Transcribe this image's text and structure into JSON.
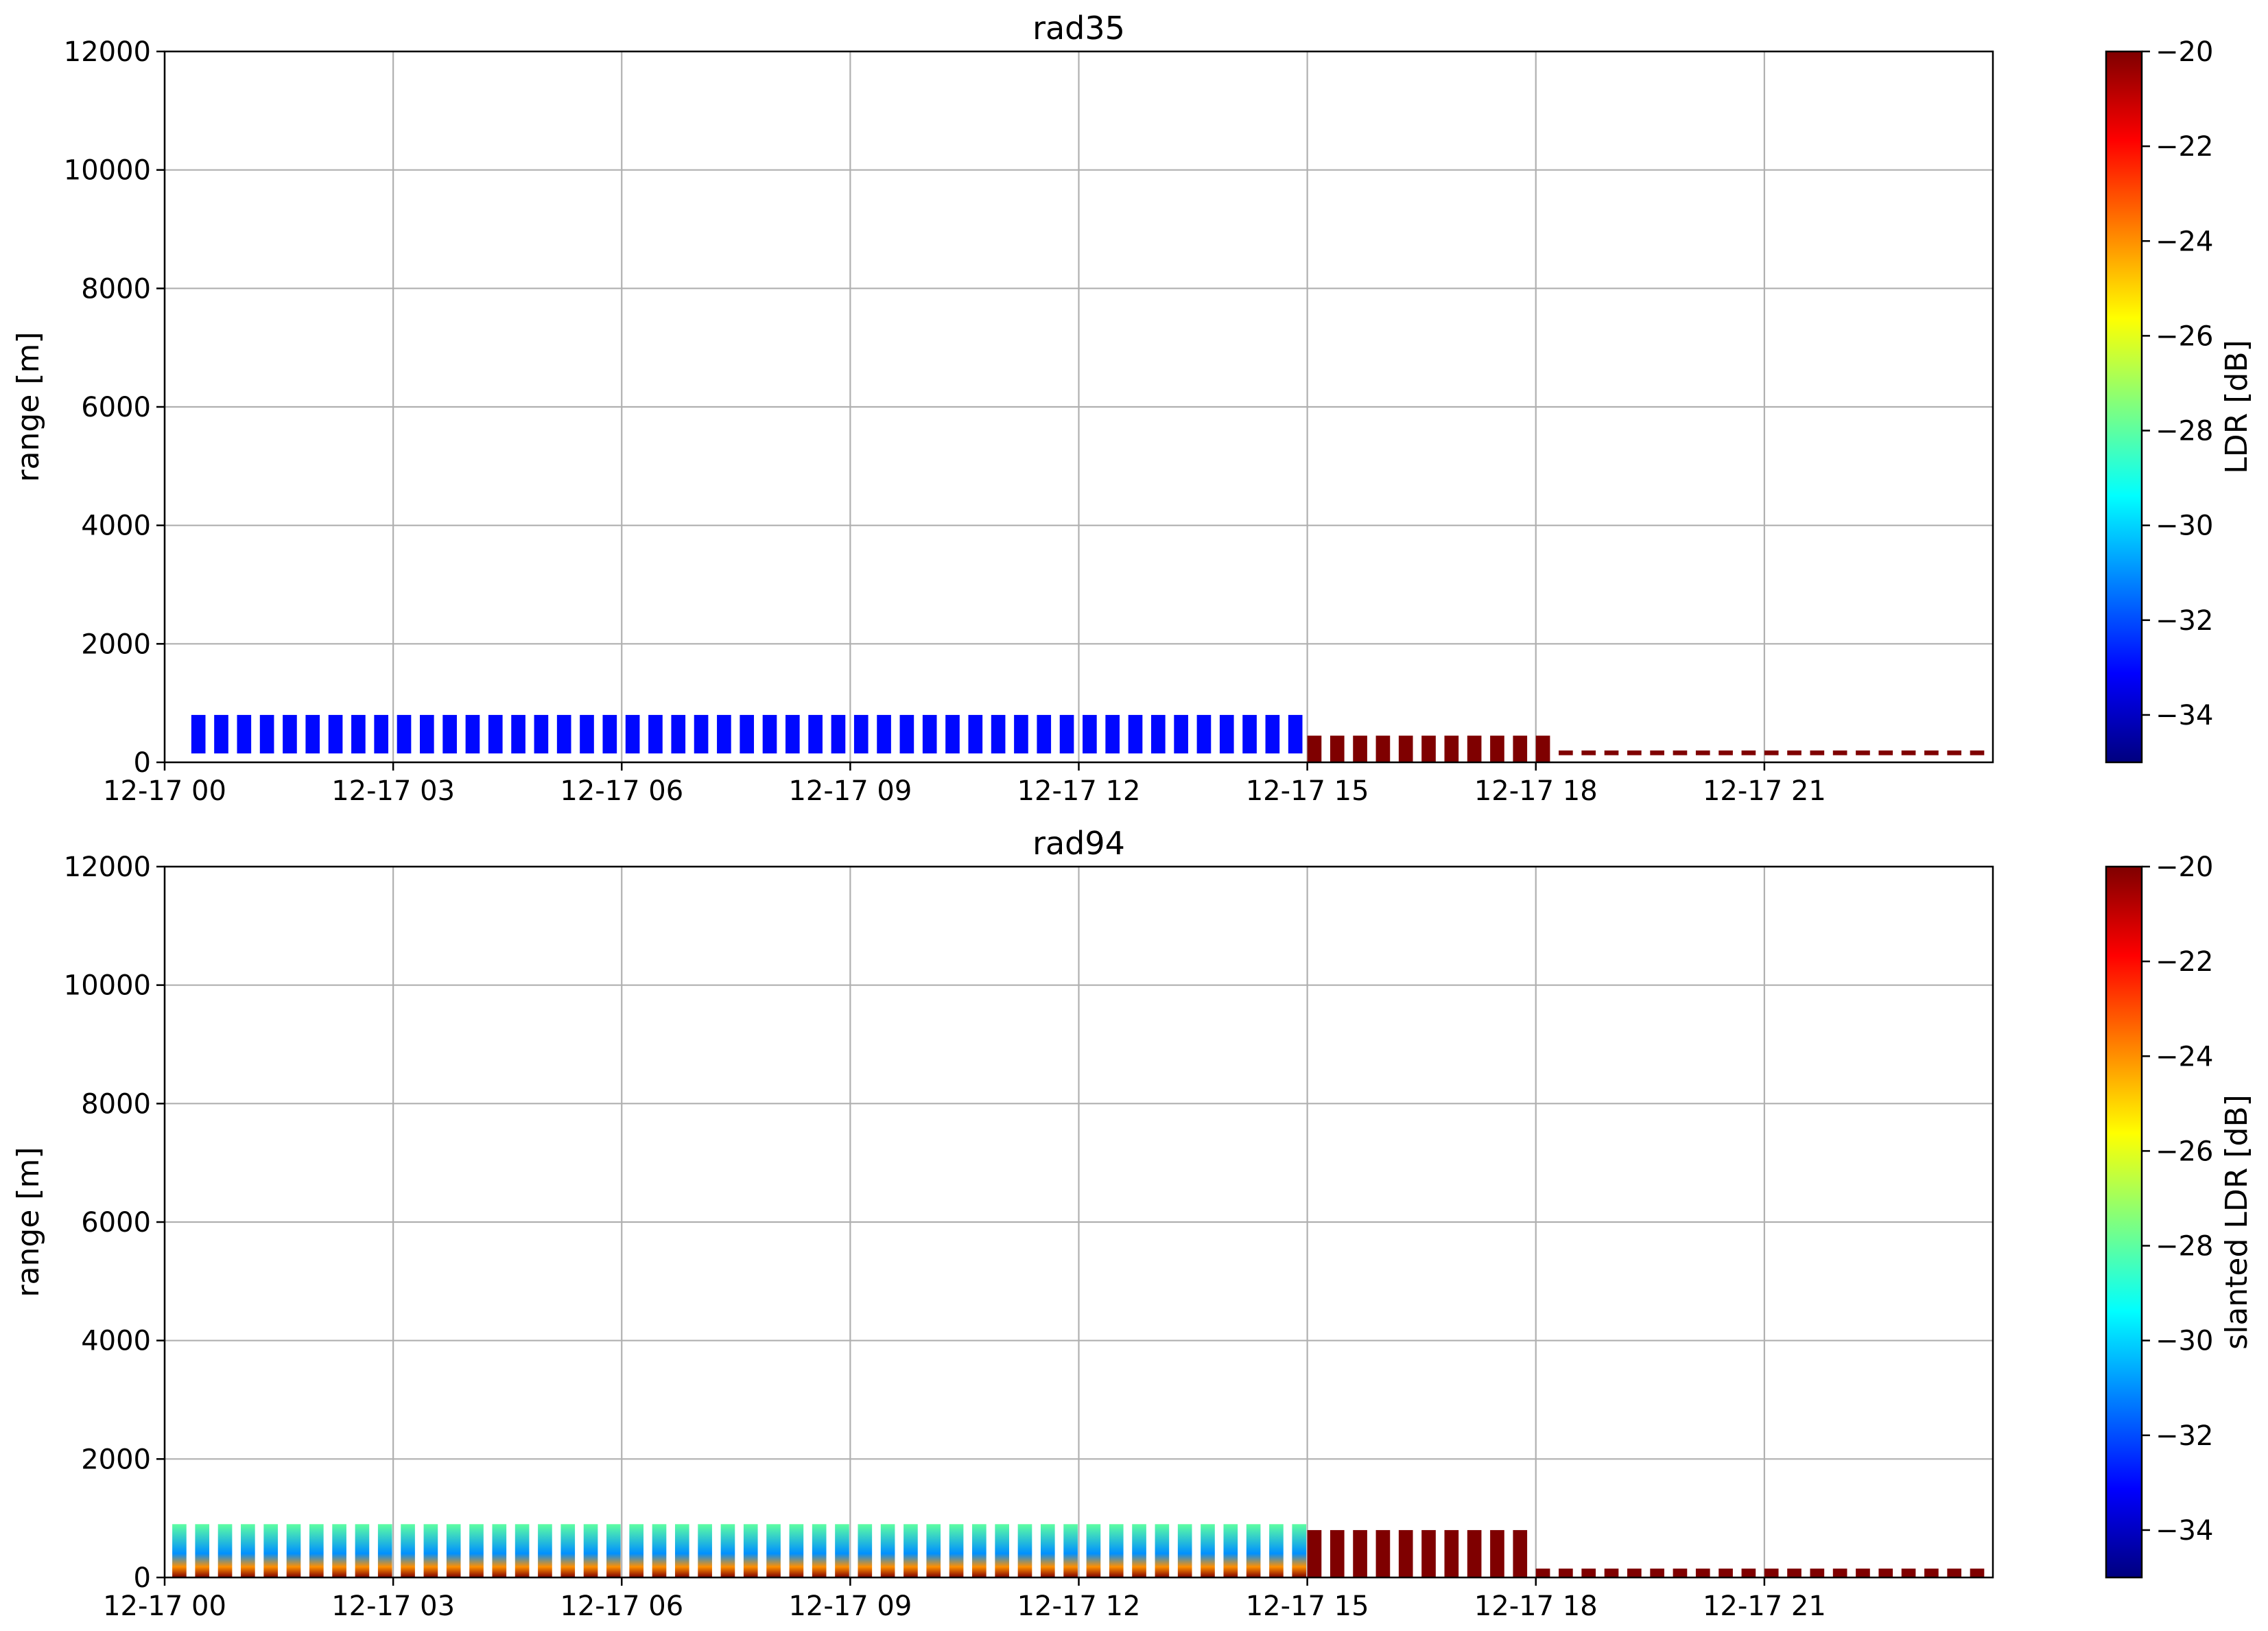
{
  "chart_data": [
    {
      "type": "heatmap",
      "title": "rad35",
      "ylabel": "range [m]",
      "xlabel": "",
      "ylim": [
        0,
        12000
      ],
      "yticks": [
        0,
        2000,
        4000,
        6000,
        8000,
        10000,
        12000
      ],
      "xlim_hours": [
        0,
        24
      ],
      "xticks": [
        {
          "hour": 0,
          "label": "12-17 00"
        },
        {
          "hour": 3,
          "label": "12-17 03"
        },
        {
          "hour": 6,
          "label": "12-17 06"
        },
        {
          "hour": 9,
          "label": "12-17 09"
        },
        {
          "hour": 12,
          "label": "12-17 12"
        },
        {
          "hour": 15,
          "label": "12-17 15"
        },
        {
          "hour": 18,
          "label": "12-17 18"
        },
        {
          "hour": 21,
          "label": "12-17 21"
        }
      ],
      "grid": true,
      "colorbar": {
        "label": "LDR [dB]",
        "range": [
          -35,
          -20
        ],
        "ticks": [
          -20,
          -22,
          -24,
          -26,
          -28,
          -30,
          -32,
          -34
        ],
        "tick_labels": [
          "−20",
          "−22",
          "−24",
          "−26",
          "−28",
          "−30",
          "−32",
          "−34"
        ],
        "colormap": [
          "#00007f",
          "#0000ff",
          "#007fff",
          "#00ffff",
          "#7fff7f",
          "#ffff00",
          "#ff7f00",
          "#ff0000",
          "#7f0000"
        ]
      },
      "echo_segments": [
        {
          "start_hour": 0.35,
          "end_hour": 15.0,
          "period_hours": 0.3,
          "top_m": 800,
          "base_m": 150,
          "ldr_db": -33
        },
        {
          "start_hour": 15.0,
          "end_hour": 18.3,
          "period_hours": 0.3,
          "top_m": 450,
          "base_m": 0,
          "ldr_db": -20
        },
        {
          "start_hour": 18.3,
          "end_hour": 24.0,
          "period_hours": 0.3,
          "top_m": 200,
          "base_m": 120,
          "ldr_db": -20
        }
      ]
    },
    {
      "type": "heatmap",
      "title": "rad94",
      "ylabel": "range [m]",
      "xlabel": "",
      "ylim": [
        0,
        12000
      ],
      "yticks": [
        0,
        2000,
        4000,
        6000,
        8000,
        10000,
        12000
      ],
      "xlim_hours": [
        0,
        24
      ],
      "xticks": [
        {
          "hour": 0,
          "label": "12-17 00"
        },
        {
          "hour": 3,
          "label": "12-17 03"
        },
        {
          "hour": 6,
          "label": "12-17 06"
        },
        {
          "hour": 9,
          "label": "12-17 09"
        },
        {
          "hour": 12,
          "label": "12-17 12"
        },
        {
          "hour": 15,
          "label": "12-17 15"
        },
        {
          "hour": 18,
          "label": "12-17 18"
        },
        {
          "hour": 21,
          "label": "12-17 21"
        }
      ],
      "grid": true,
      "colorbar": {
        "label": "slanted LDR [dB]",
        "range": [
          -35,
          -20
        ],
        "ticks": [
          -20,
          -22,
          -24,
          -26,
          -28,
          -30,
          -32,
          -34
        ],
        "tick_labels": [
          "−20",
          "−22",
          "−24",
          "−26",
          "−28",
          "−30",
          "−32",
          "−34"
        ],
        "colormap": [
          "#00007f",
          "#0000ff",
          "#007fff",
          "#00ffff",
          "#7fff7f",
          "#ffff00",
          "#ff7f00",
          "#ff0000",
          "#7f0000"
        ]
      },
      "echo_segments": [
        {
          "start_hour": 0.1,
          "end_hour": 15.0,
          "period_hours": 0.3,
          "top_m": 900,
          "base_m": 0,
          "ldr_db_top": -28,
          "ldr_db_bottom": -20
        },
        {
          "start_hour": 15.0,
          "end_hour": 18.0,
          "period_hours": 0.3,
          "top_m": 800,
          "base_m": 0,
          "ldr_db": -20
        },
        {
          "start_hour": 18.0,
          "end_hour": 24.0,
          "period_hours": 0.3,
          "top_m": 150,
          "base_m": 0,
          "ldr_db": -20
        }
      ]
    }
  ]
}
